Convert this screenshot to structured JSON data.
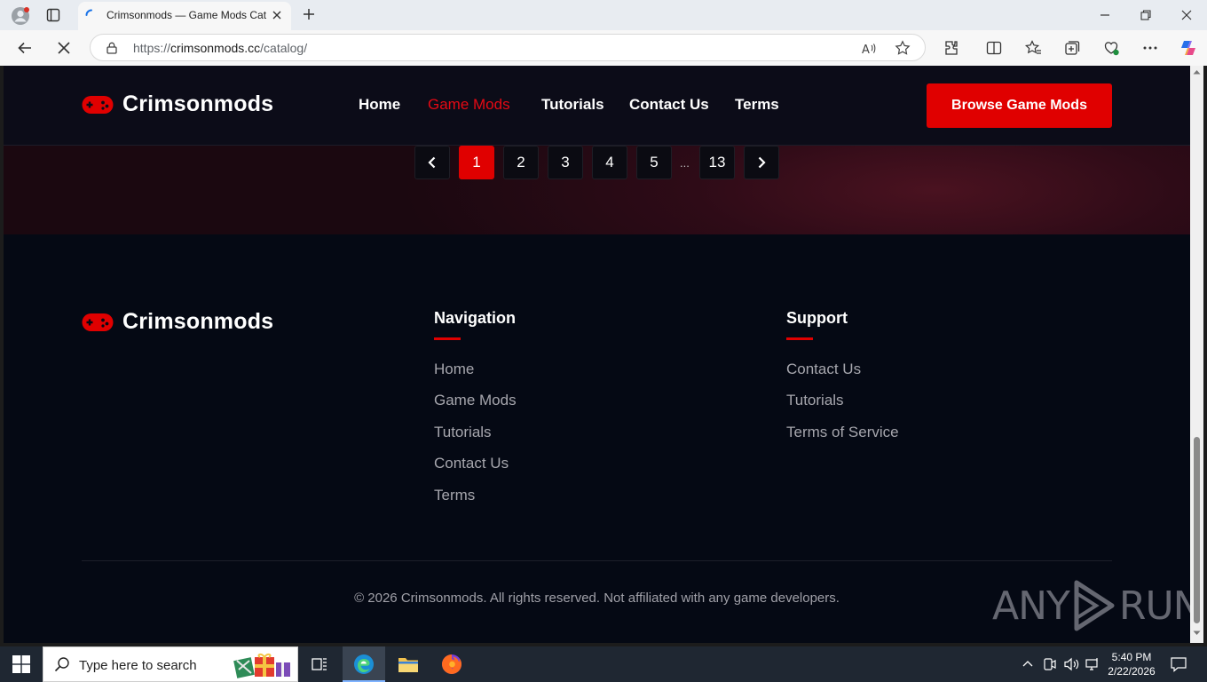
{
  "browser": {
    "tab_title": "Crimsonmods — Game Mods Catalog",
    "url_scheme": "https://",
    "url_host": "crimsonmods.cc",
    "url_path": "/catalog/"
  },
  "site": {
    "brand": "Crimsonmods",
    "nav": [
      "Home",
      "Game Mods",
      "Tutorials",
      "Contact Us",
      "Terms"
    ],
    "active_nav": "Game Mods",
    "cta": "Browse Game Mods",
    "accent_color": "#e00000"
  },
  "pagination": {
    "pages": [
      "1",
      "2",
      "3",
      "4",
      "5"
    ],
    "current": "1",
    "ellipsis": "...",
    "last": "13"
  },
  "footer": {
    "brand": "Crimsonmods",
    "navigation_heading": "Navigation",
    "navigation_links": [
      "Home",
      "Game Mods",
      "Tutorials",
      "Contact Us",
      "Terms"
    ],
    "support_heading": "Support",
    "support_links": [
      "Contact Us",
      "Tutorials",
      "Terms of Service"
    ],
    "copyright": "© 2026 Crimsonmods. All rights reserved. Not affiliated with any game developers."
  },
  "watermark": {
    "left": "ANY",
    "right": "RUN"
  },
  "taskbar": {
    "search_placeholder": "Type here to search",
    "time": "5:40 PM",
    "date": "2/22/2026"
  }
}
